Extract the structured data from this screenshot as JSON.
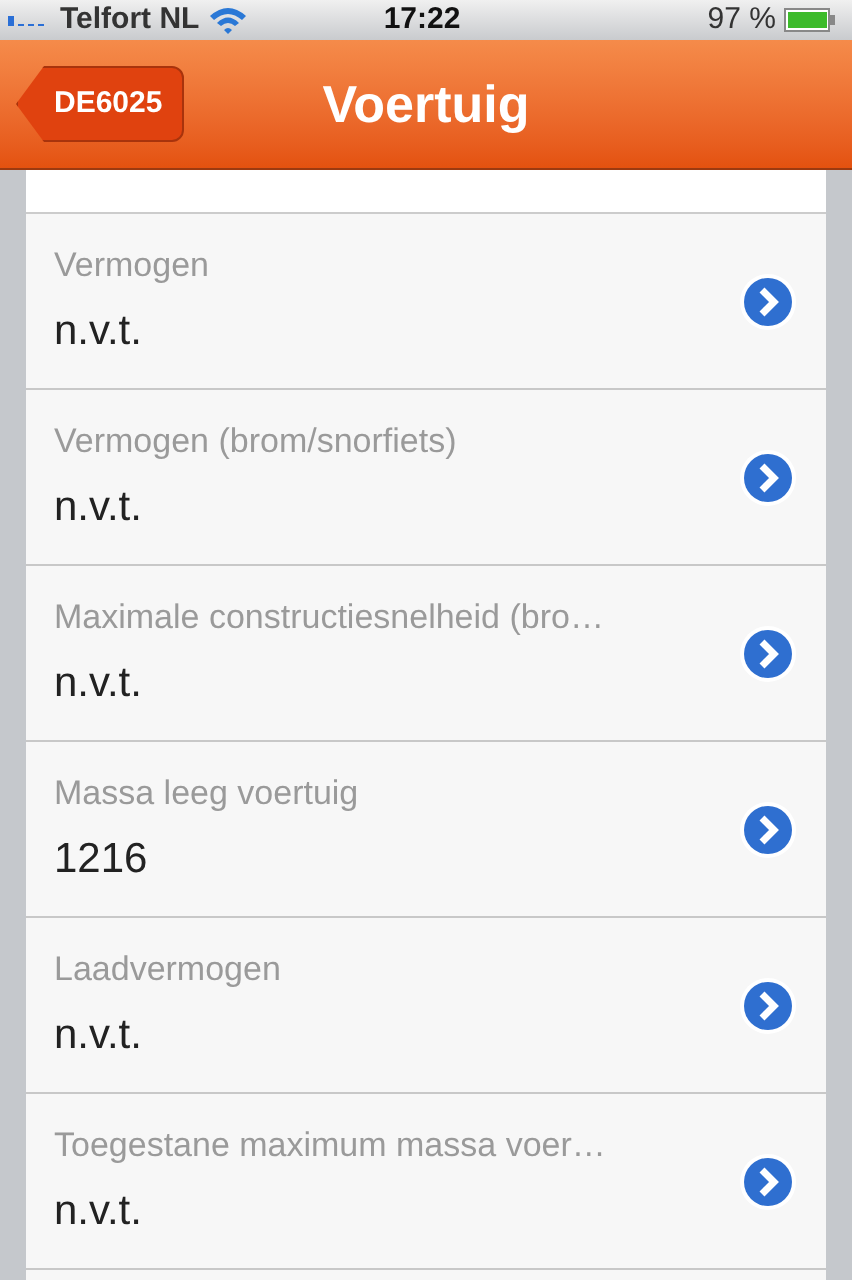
{
  "status_bar": {
    "carrier": "Telfort NL",
    "time": "17:22",
    "battery": "97 %"
  },
  "nav": {
    "back": "DE6025",
    "title": "Voertuig"
  },
  "rows": [
    {
      "label": "Vermogen",
      "value": "n.v.t."
    },
    {
      "label": "Vermogen (brom/snorfiets)",
      "value": "n.v.t."
    },
    {
      "label": "Maximale constructiesnelheid (bro…",
      "value": "n.v.t."
    },
    {
      "label": "Massa leeg voertuig",
      "value": "1216"
    },
    {
      "label": "Laadvermogen",
      "value": "n.v.t."
    },
    {
      "label": "Toegestane maximum massa voer…",
      "value": "n.v.t."
    }
  ]
}
